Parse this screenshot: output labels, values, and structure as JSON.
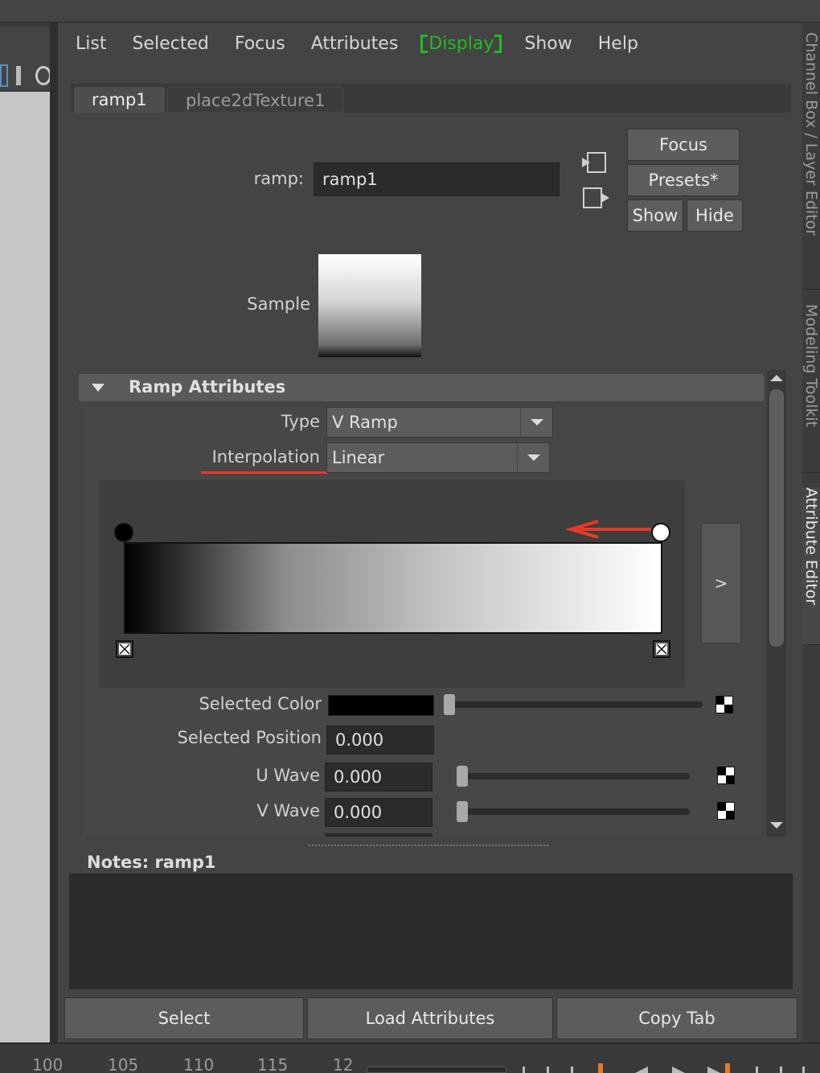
{
  "menubar": {
    "items": [
      "List",
      "Selected",
      "Focus",
      "Attributes",
      "Display",
      "Show",
      "Help"
    ]
  },
  "tabs": [
    "ramp1",
    "place2dTexture1"
  ],
  "node": {
    "label": "ramp:",
    "name": "ramp1"
  },
  "buttons": {
    "focus": "Focus",
    "presets": "Presets*",
    "show": "Show",
    "hide": "Hide"
  },
  "sample": {
    "label": "Sample"
  },
  "section": {
    "title": "Ramp Attributes",
    "type_label": "Type",
    "type_value": "V Ramp",
    "interp_label": "Interpolation",
    "interp_value": "Linear",
    "expand_label": ">",
    "selected_color_label": "Selected Color",
    "selected_color_value": "#000000",
    "selected_position_label": "Selected Position",
    "selected_position_value": "0.000",
    "u_wave_label": "U Wave",
    "u_wave_value": "0.000",
    "v_wave_label": "V Wave",
    "v_wave_value": "0.000"
  },
  "notes": {
    "label": "Notes:  ramp1"
  },
  "footer": {
    "select": "Select",
    "load": "Load Attributes",
    "copy": "Copy Tab"
  },
  "side_tabs": [
    "Channel Box / Layer Editor",
    "Modeling Toolkit",
    "Attribute Editor"
  ],
  "timeline": {
    "ticks": [
      "100",
      "105",
      "110",
      "115",
      "12"
    ]
  },
  "colors": {
    "accent_display": "#22bb22",
    "annotation": "#e53a2a"
  }
}
